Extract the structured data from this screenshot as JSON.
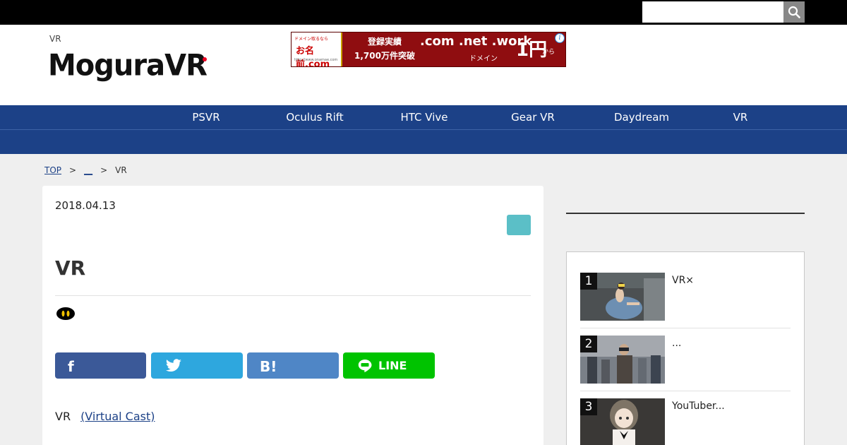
{
  "search": {
    "placeholder": "",
    "value": ""
  },
  "header": {
    "tagline": "VR",
    "logo_text": "MoguraVR"
  },
  "ad": {
    "left_top": "ドメイン取るなら",
    "left_logo": "お名前.com",
    "left_small": "http://www.onamae.com",
    "mid_line1": "登録実績",
    "mid_line2": "1,700万件突破",
    "domains": ".com .net .work",
    "domain_sub": "ドメイン",
    "price": "1円",
    "price_unit": "から",
    "info_glyph": "i"
  },
  "nav": {
    "items": [
      {
        "label": "PSVR"
      },
      {
        "label": "Oculus Rift"
      },
      {
        "label": "HTC Vive"
      },
      {
        "label": "Gear VR"
      },
      {
        "label": "Daydream"
      },
      {
        "label": "VR"
      }
    ]
  },
  "breadcrumb": {
    "top": "TOP",
    "sep": ">",
    "category": "__",
    "current": "VR"
  },
  "article": {
    "date": "2018.04.13",
    "title": "VR",
    "body_prefix": "VR",
    "body_link": "(Virtual Cast)"
  },
  "share": {
    "facebook_glyph": "f",
    "twitter_icon": "twitter-bird-icon",
    "hatena_glyph": "B!",
    "line_label": "LINE"
  },
  "colors": {
    "nav_bg": "#1c4187",
    "category_badge": "#5bbfc7",
    "facebook": "#3b5998",
    "twitter": "#2ea7de",
    "hatena": "#4f86c6",
    "line": "#00c300"
  },
  "ranking": {
    "items": [
      {
        "rank": "1",
        "title": "VR×"
      },
      {
        "rank": "2",
        "title": "..."
      },
      {
        "rank": "3",
        "title": "YouTuber..."
      }
    ]
  }
}
